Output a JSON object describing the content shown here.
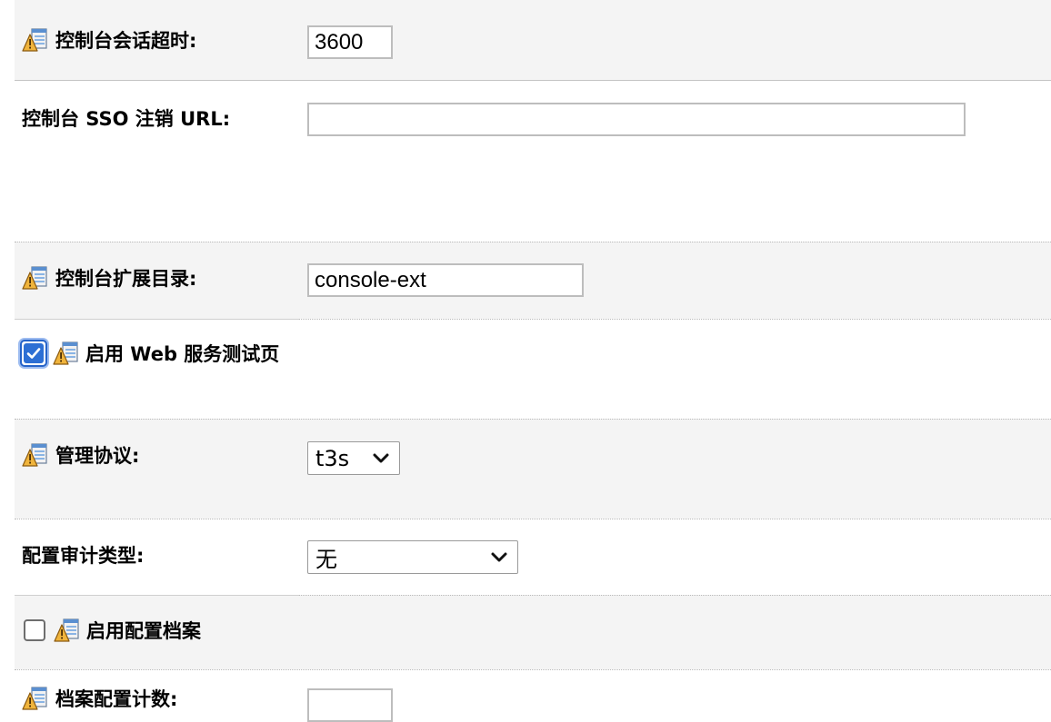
{
  "console_session_timeout": {
    "label": "控制台会话超时:",
    "value": "3600"
  },
  "console_sso_logout_url": {
    "label": "控制台 SSO 注销 URL:",
    "value": ""
  },
  "console_extension_dir": {
    "label": "控制台扩展目录:",
    "value": "console-ext"
  },
  "web_service_test_page": {
    "label": "启用 Web 服务测试页",
    "checked": true
  },
  "admin_protocol": {
    "label": "管理协议:",
    "selected": "t3s"
  },
  "config_audit_type": {
    "label": "配置审计类型:",
    "selected": "无"
  },
  "config_archive": {
    "label": "启用配置档案",
    "checked": false
  },
  "archive_config_count": {
    "label": "档案配置计数:"
  },
  "icons": {
    "warning": "config-warning-icon",
    "check": "check-icon",
    "chevron": "chevron-down-icon"
  },
  "colors": {
    "row_shade": "#f4f4f4",
    "checkbox_blue": "#2d6fd4",
    "icon_orange": "#e6a23c"
  }
}
